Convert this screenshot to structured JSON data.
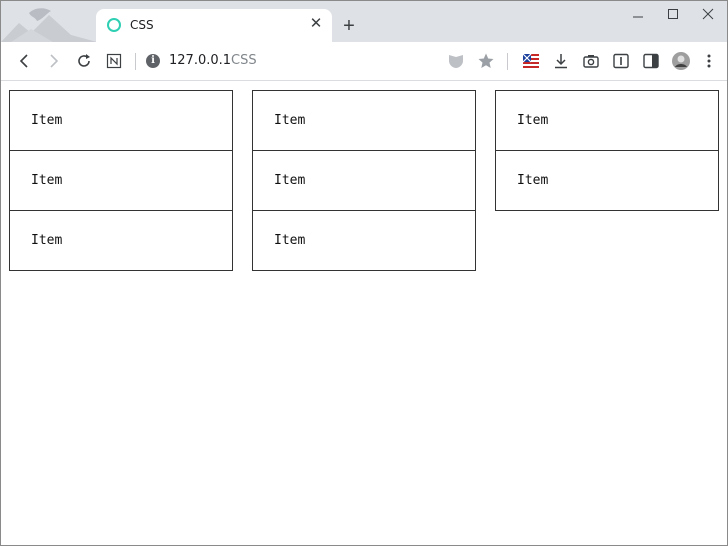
{
  "browser": {
    "tab": {
      "title": "CSS",
      "favicon_color": "#2ecfb3"
    },
    "new_tab_label": "+",
    "window_controls": {
      "minimize": "—",
      "maximize": "☐",
      "close": "✕"
    },
    "address": {
      "host": "127.0.0.1",
      "page_title": "CSS"
    },
    "toolbar_icons": [
      "back-icon",
      "forward-icon",
      "reload-icon",
      "notion-icon",
      "info-icon",
      "shield-icon",
      "star-icon",
      "flag-icon",
      "download-icon",
      "camera-icon",
      "reader-icon",
      "sidebar-icon",
      "avatar",
      "menu-icon"
    ]
  },
  "page": {
    "columns": [
      {
        "items": [
          "Item",
          "Item",
          "Item"
        ]
      },
      {
        "items": [
          "Item",
          "Item",
          "Item"
        ]
      },
      {
        "items": [
          "Item",
          "Item"
        ]
      }
    ]
  },
  "colors": {
    "tabstrip": "#dee1e6",
    "item_border": "#333333",
    "accent": "#2ecfb3"
  }
}
